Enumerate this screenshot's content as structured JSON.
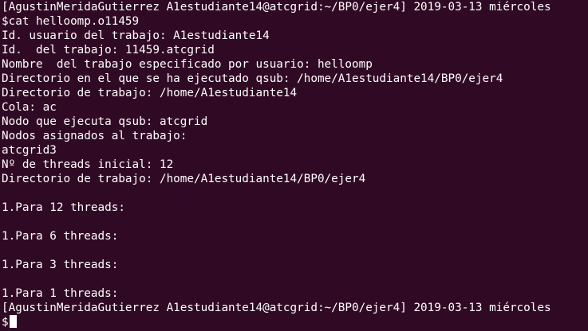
{
  "terminal": {
    "lines": [
      "[AgustinMeridaGutierrez A1estudiante14@atcgrid:~/BP0/ejer4] 2019-03-13 miércoles",
      "$cat helloomp.o11459",
      "Id. usuario del trabajo: A1estudiante14",
      "Id.  del trabajo: 11459.atcgrid",
      "Nombre  del trabajo especificado por usuario: helloomp",
      "Directorio en el que se ha ejecutado qsub: /home/A1estudiante14/BP0/ejer4",
      "Directorio de trabajo: /home/A1estudiante14",
      "Cola: ac",
      "Nodo que ejecuta qsub: atcgrid",
      "Nodos asignados al trabajo:",
      "atcgrid3",
      "Nº de threads inicial: 12",
      "Directorio de trabajo: /home/A1estudiante14/BP0/ejer4",
      "",
      "1.Para 12 threads:",
      "",
      "1.Para 6 threads:",
      "",
      "1.Para 3 threads:",
      "",
      "1.Para 1 threads:",
      "[AgustinMeridaGutierrez A1estudiante14@atcgrid:~/BP0/ejer4] 2019-03-13 miércoles"
    ],
    "prompt": "$",
    "background": "#300a24",
    "foreground": "#ffffff"
  }
}
